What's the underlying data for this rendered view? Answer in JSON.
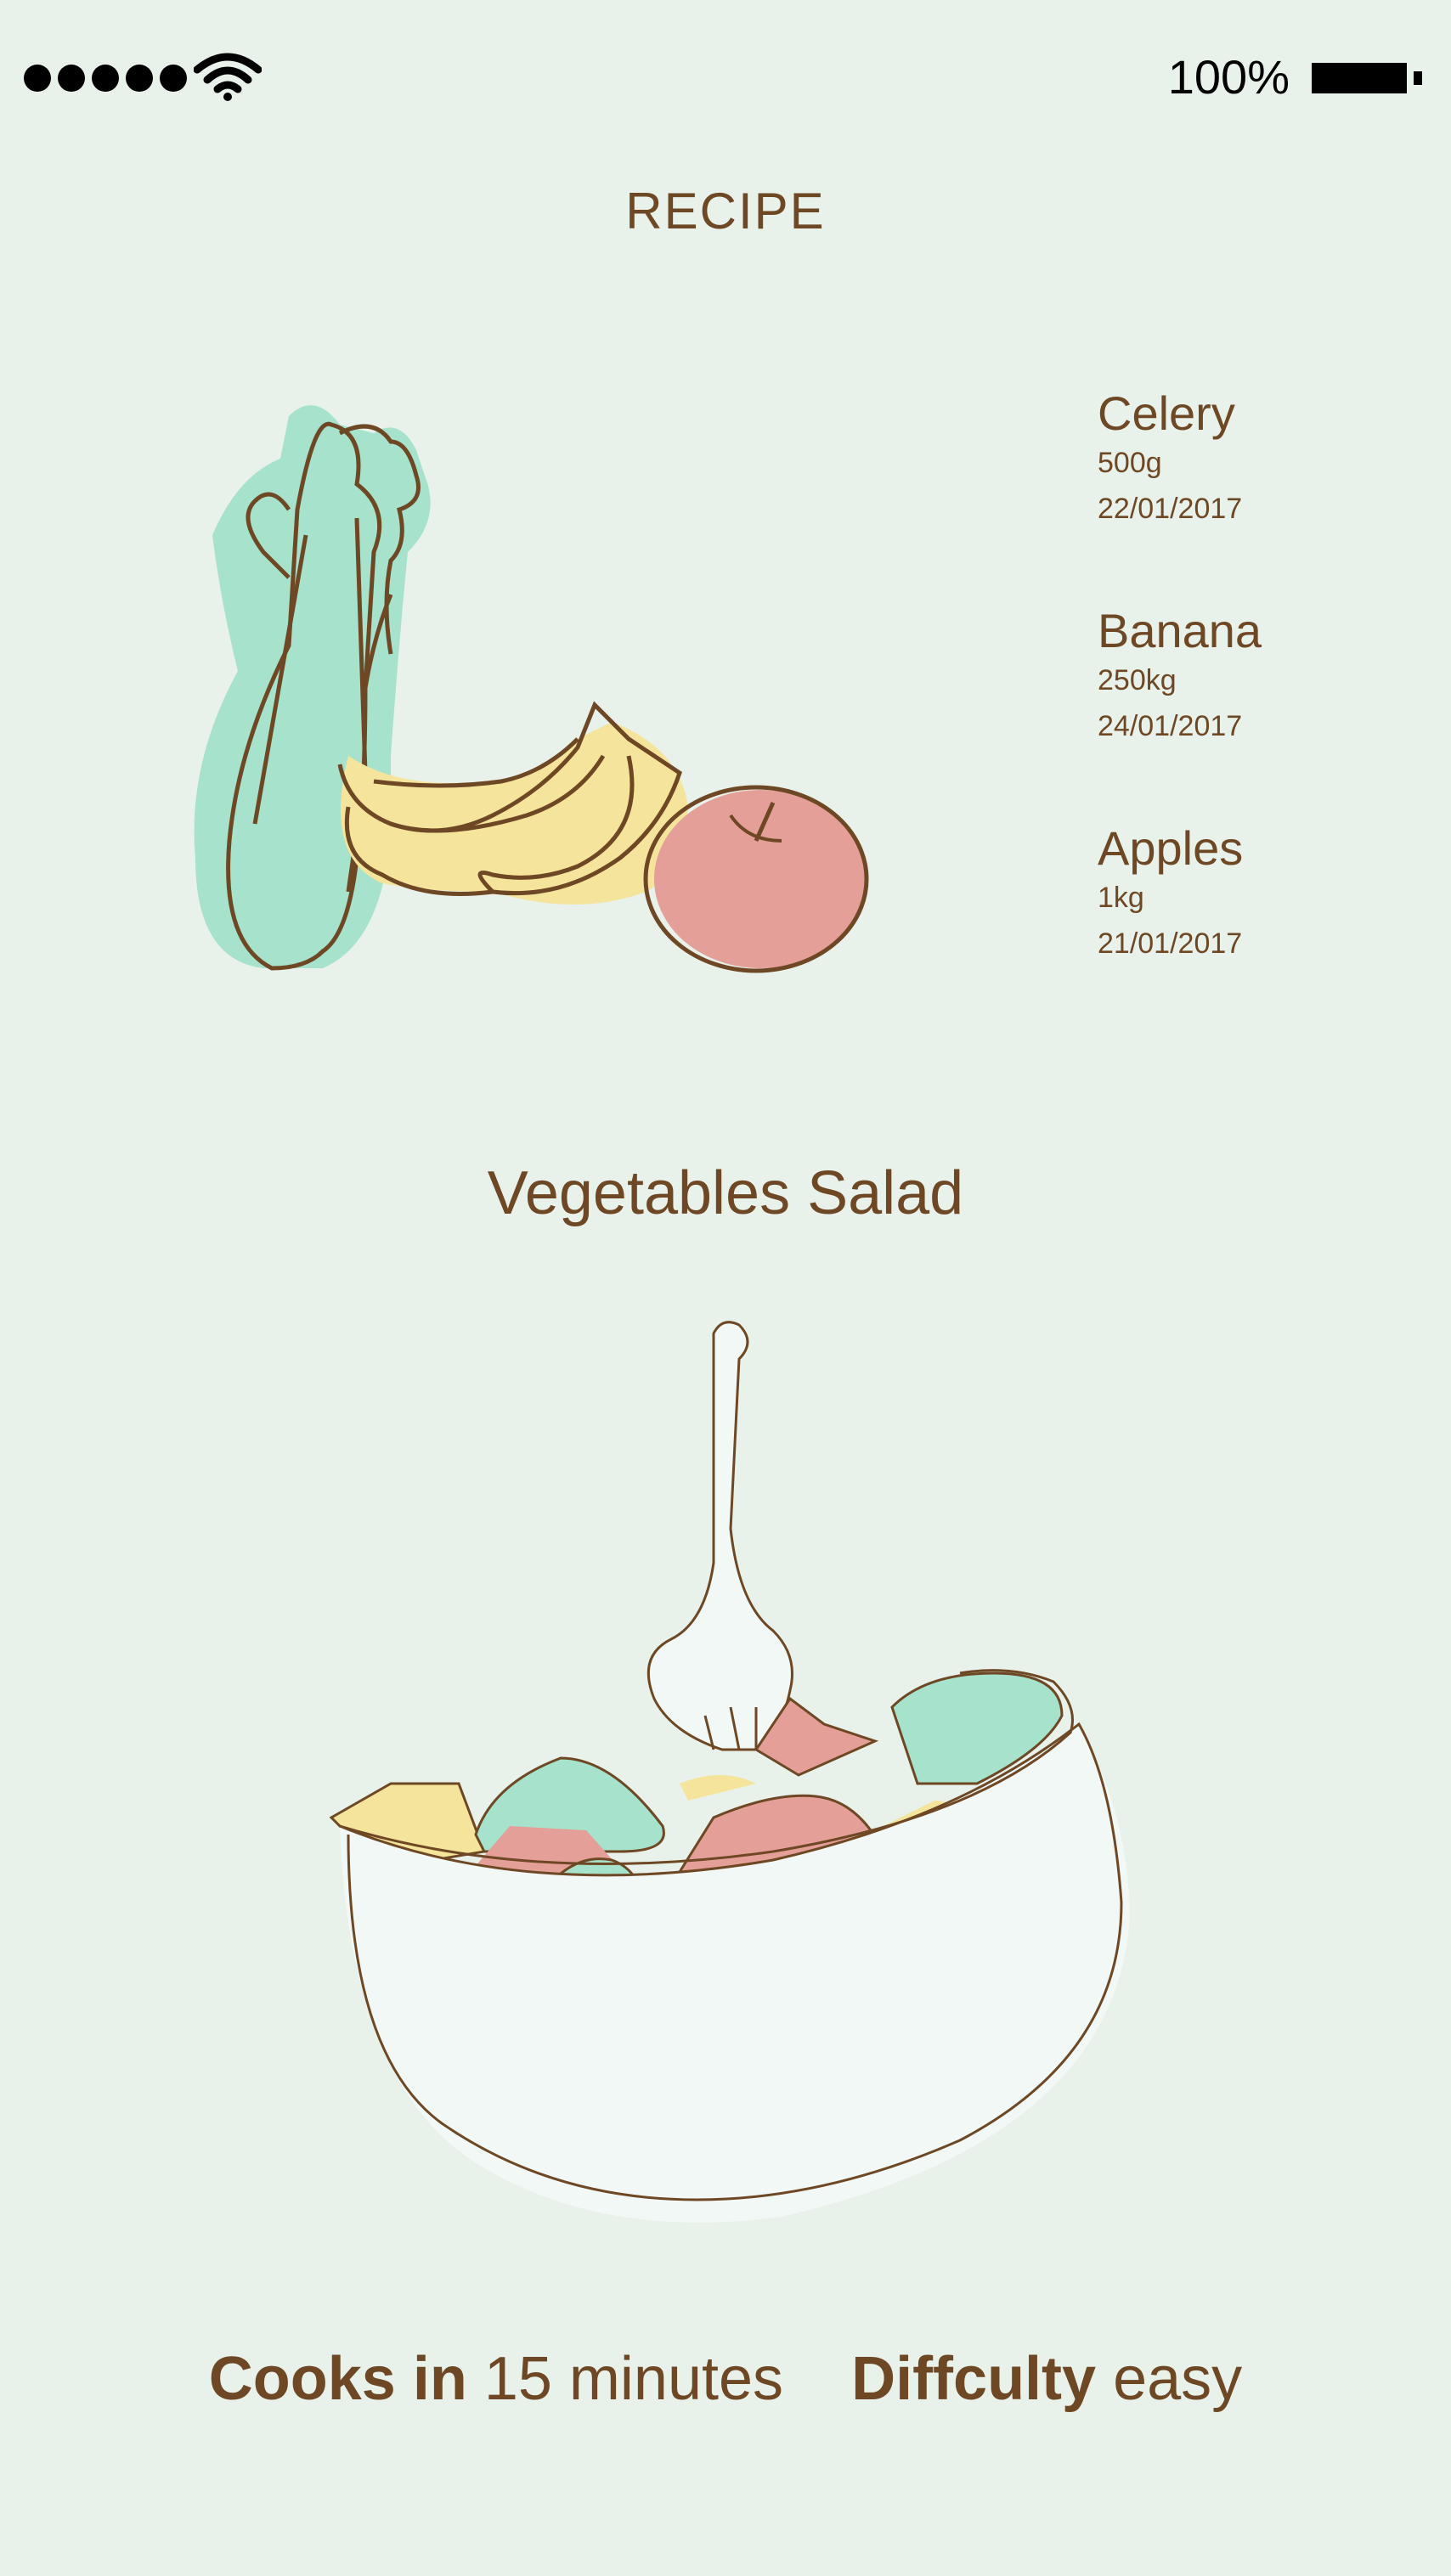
{
  "status_bar": {
    "battery_percent": "100%",
    "signal_bars": 5,
    "wifi_icon": "wifi-icon",
    "battery_icon": "battery-full-icon"
  },
  "header": {
    "title": "RECIPE"
  },
  "ingredients": [
    {
      "name": "Celery",
      "amount": "500g",
      "date": "22/01/2017"
    },
    {
      "name": "Banana",
      "amount": "250kg",
      "date": "24/01/2017"
    },
    {
      "name": "Apples",
      "amount": "1kg",
      "date": "21/01/2017"
    }
  ],
  "dish": {
    "title": "Vegetables Salad"
  },
  "footer": {
    "cooks_label": "Cooks in",
    "cooks_value": "15 minutes",
    "difficulty_label": "Diffculty",
    "difficulty_value": "easy"
  },
  "colors": {
    "background": "#e8f1ea",
    "text_brown": "#6e4825",
    "celery_green": "#a6e2cc",
    "banana_yellow": "#f5e49c",
    "apple_red": "#e4a098"
  }
}
